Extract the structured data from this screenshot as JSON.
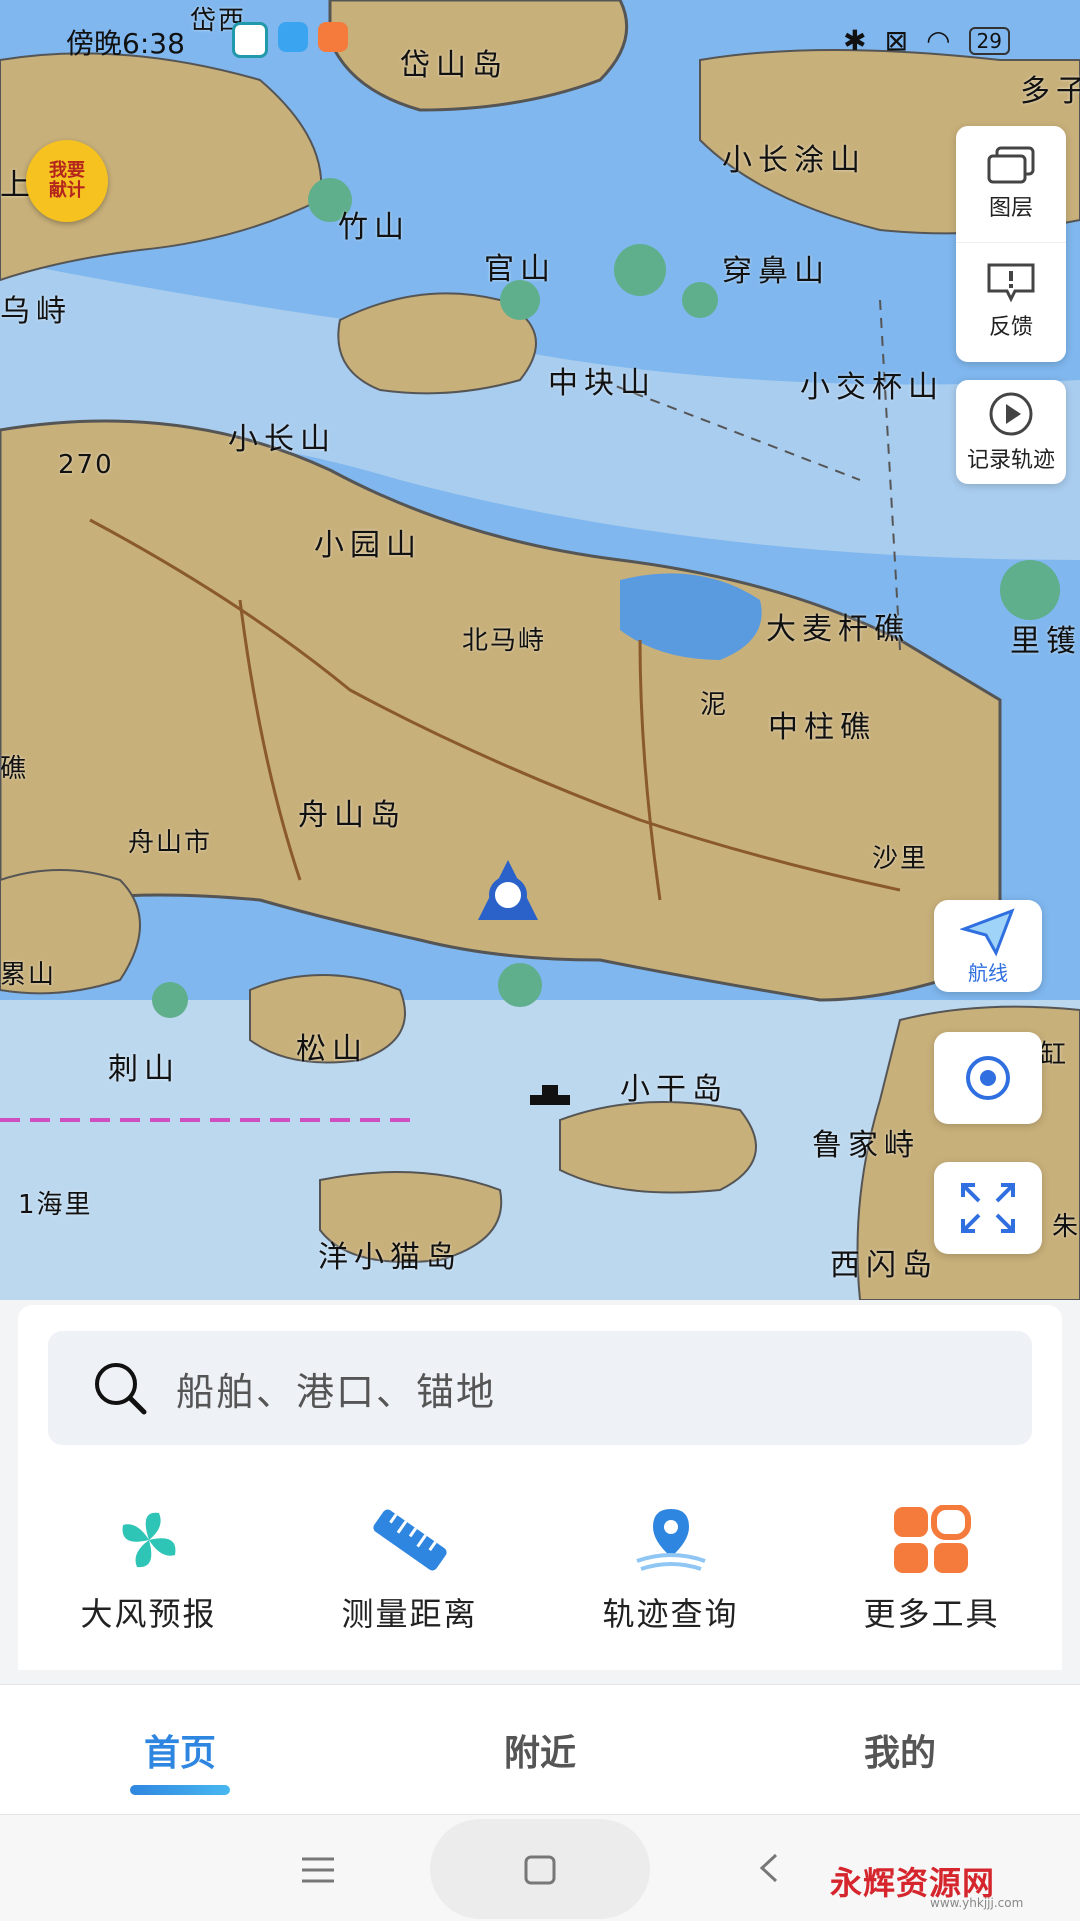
{
  "status_bar": {
    "time": "傍晚6:38",
    "battery": "29"
  },
  "mascot": {
    "line1": "我要",
    "line2": "献计"
  },
  "map": {
    "places": [
      "岱山岛",
      "小长涂山",
      "竹山",
      "官山",
      "穿鼻山",
      "乌峙",
      "中块山",
      "小交杯山",
      "小长山",
      "小园山",
      "北马峙",
      "大麦杆礁",
      "里镬",
      "中柱礁",
      "舟山岛",
      "舟山市",
      "沙里",
      "松山",
      "刺山",
      "小干岛",
      "鲁家峙",
      "洋小猫岛",
      "西闪岛",
      "上鳖山",
      "岱西",
      "多子",
      "泥",
      "270",
      "1海里",
      "礁",
      "累山",
      "缸",
      "朱"
    ],
    "scale_label": "1海里",
    "depth_270": "270"
  },
  "tools": {
    "layers": "图层",
    "feedback": "反馈",
    "record_track": "记录轨迹",
    "route": "航线"
  },
  "search": {
    "placeholder": "船舶、港口、锚地"
  },
  "quick_actions": [
    {
      "label": "大风预报",
      "icon": "pinwheel-icon"
    },
    {
      "label": "测量距离",
      "icon": "ruler-icon"
    },
    {
      "label": "轨迹查询",
      "icon": "location-track-icon"
    },
    {
      "label": "更多工具",
      "icon": "grid-icon"
    }
  ],
  "tabs": [
    {
      "label": "首页",
      "active": true
    },
    {
      "label": "附近",
      "active": false
    },
    {
      "label": "我的",
      "active": false
    }
  ],
  "watermark": {
    "name": "永辉资源网",
    "url": "www.yhkjjj.com"
  },
  "colors": {
    "land": "#c8b07a",
    "sea": "#7fb7ee",
    "accent": "#2f86e0"
  }
}
